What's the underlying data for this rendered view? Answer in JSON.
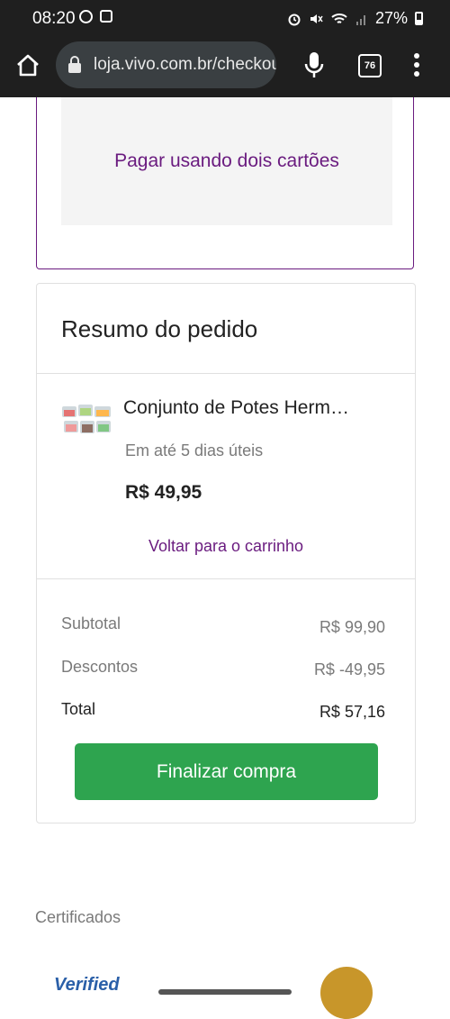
{
  "status_bar": {
    "time": "08:20",
    "battery": "27%"
  },
  "browser": {
    "url": "loja.vivo.com.br/checkout",
    "tab_count": "76"
  },
  "payment": {
    "split_label": "Pagar usando dois cartões"
  },
  "summary": {
    "title": "Resumo do pedido",
    "product": {
      "name": "Conjunto de Potes Herm…",
      "delivery": "Em até 5 dias úteis",
      "price": "R$ 49,95"
    },
    "back_to_cart": "Voltar para o carrinho",
    "subtotal_label": "Subtotal",
    "subtotal_value": "R$ 99,90",
    "discount_label": "Descontos",
    "discount_value": "R$ -49,95",
    "total_label": "Total",
    "total_value": "R$ 57,16",
    "finalize_label": "Finalizar compra"
  },
  "certificates": {
    "title": "Certificados",
    "logo_left_text": "Verified"
  },
  "colors": {
    "brand_purple": "#6a1b7f",
    "button_green": "#2ea44f",
    "statusbar_bg": "#1f1f1f"
  }
}
